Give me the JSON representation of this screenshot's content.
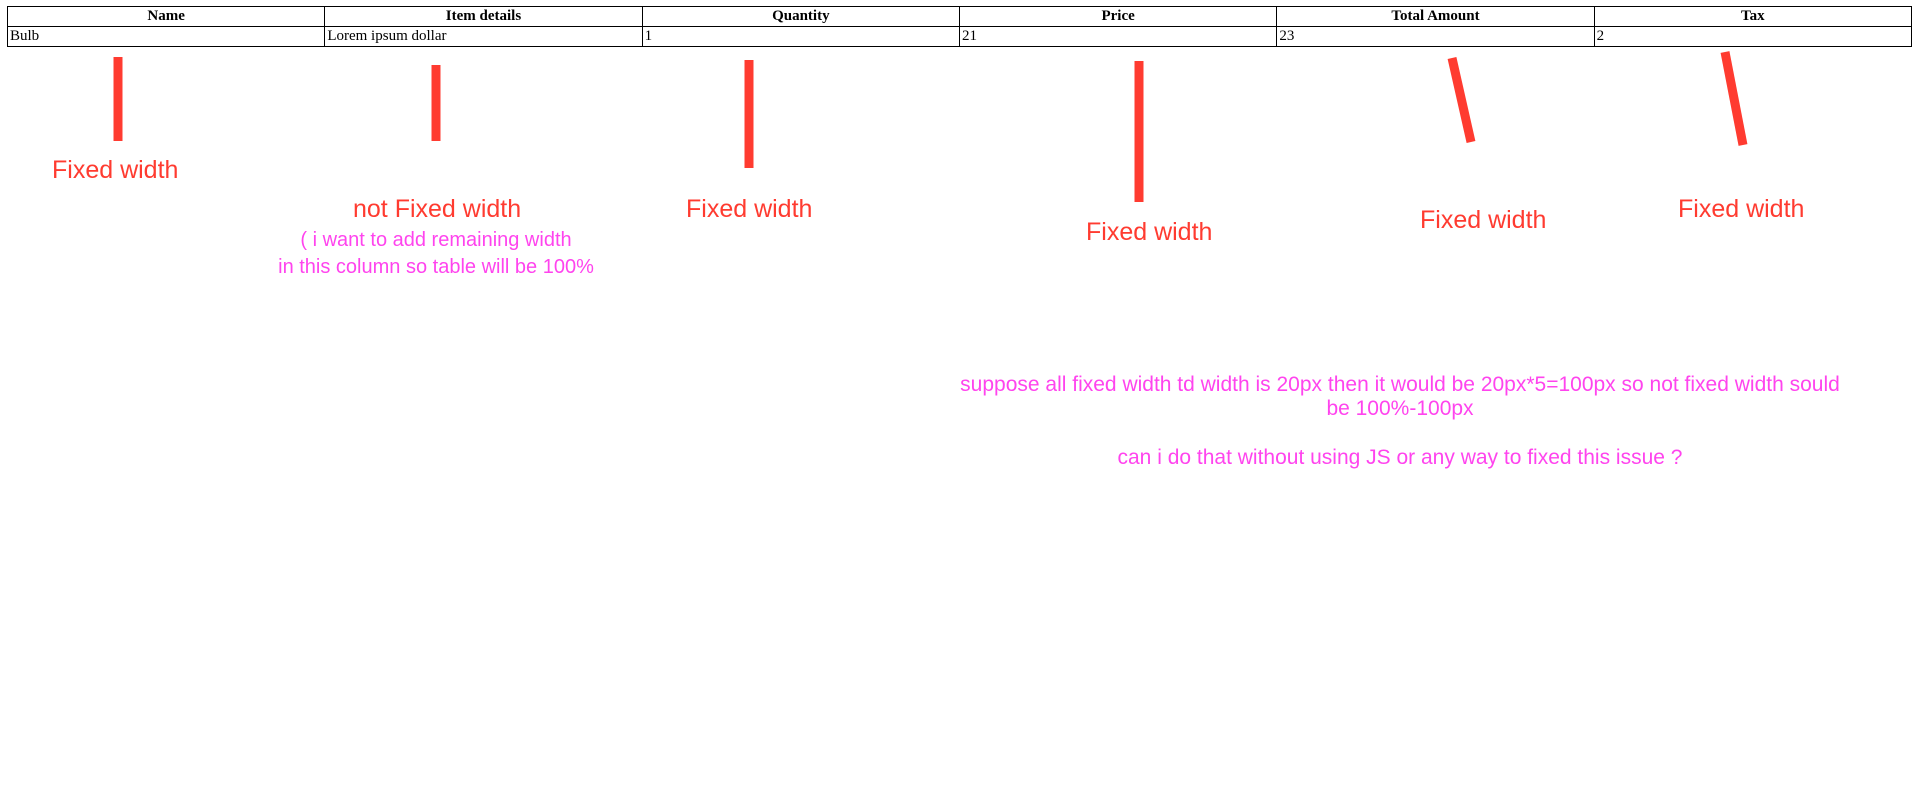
{
  "table": {
    "name": "item-table",
    "columns": [
      "Name",
      "Item details",
      "Quantity",
      "Price",
      "Total Amount",
      "Tax"
    ],
    "rows": [
      [
        "Bulb",
        "Lorem ipsum dollar",
        "1",
        "21",
        "23",
        "2"
      ]
    ]
  },
  "annotations": {
    "column_notes": [
      {
        "text": "Fixed width",
        "column": "Name"
      },
      {
        "text": "not Fixed width",
        "column": "Item details"
      },
      {
        "text": "Fixed width",
        "column": "Quantity"
      },
      {
        "text": "Fixed width",
        "column": "Price"
      },
      {
        "text": "Fixed width",
        "column": "Total Amount"
      },
      {
        "text": "Fixed width",
        "column": "Tax"
      }
    ],
    "item_details_note_line1": "( i want to add remaining width",
    "item_details_note_line2": "in this column so table will be 100%",
    "explanation": "suppose all fixed width td width is 20px then it would be 20px*5=100px so not fixed width sould be 100%-100px",
    "question": "can i do that without using JS or any way to fixed this issue ?"
  },
  "colors": {
    "marker_red": "#ff3b30",
    "note_magenta": "#ff44ee",
    "table_border": "#000000",
    "background": "#ffffff"
  }
}
